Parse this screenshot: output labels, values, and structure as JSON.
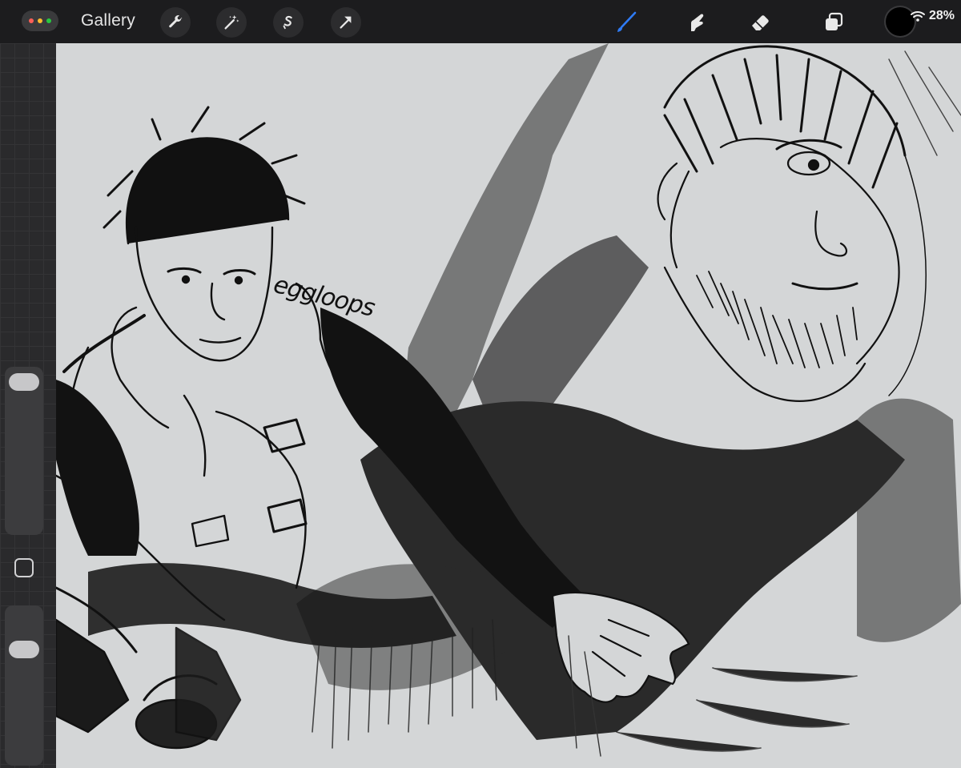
{
  "toolbar": {
    "gallery_label": "Gallery",
    "actions_icon": "wrench-icon",
    "adjustments_icon": "magic-wand-icon",
    "selection_icon": "selection-s-icon",
    "transform_icon": "arrow-cursor-icon",
    "brush_icon": "brush-icon",
    "smudge_icon": "smudge-finger-icon",
    "eraser_icon": "eraser-icon",
    "layers_icon": "layers-icon",
    "active_tool": "brush",
    "active_color": "#000000",
    "brush_active_color": "#2f7bf5"
  },
  "status": {
    "battery": "28%",
    "wifi_icon": "wifi-icon"
  },
  "sidebar": {
    "brush_size_level": 0.05,
    "opacity_level": 0.3,
    "modify_button_icon": "square-icon"
  },
  "canvas": {
    "signature": "eggloops",
    "background_color": "#d4d6d7"
  }
}
